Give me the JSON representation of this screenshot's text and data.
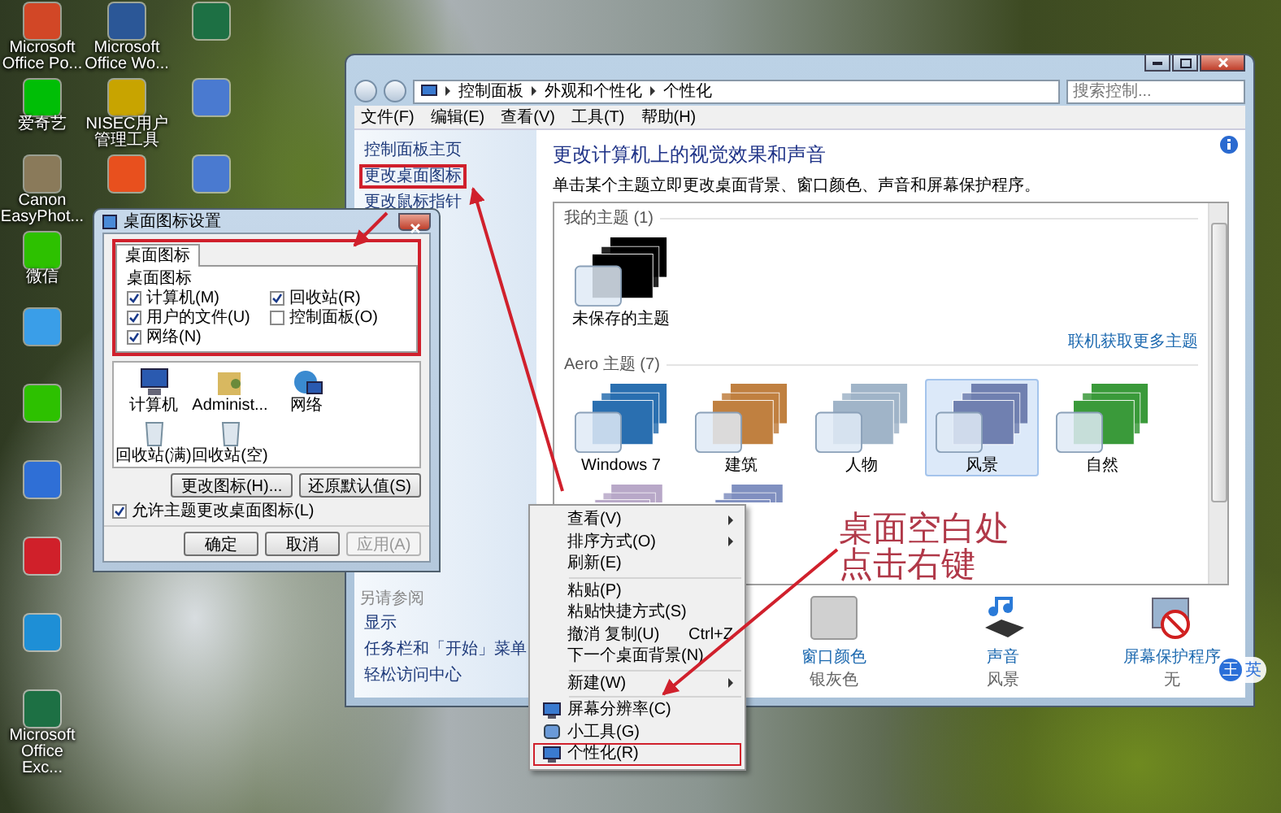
{
  "desktop_icon_columns": [
    [
      {
        "label": "Microsoft Office Po...",
        "color": "#d24726"
      },
      {
        "label": "爱奇艺",
        "color": "#00be06"
      },
      {
        "label": "Canon EasyPhot...",
        "color": "#8a7a5a"
      },
      {
        "label": "微信",
        "color": "#2dc100"
      },
      {
        "color": "#3a9ee8"
      },
      {
        "color": "#2dc100"
      },
      {
        "color": "#2f6fd6"
      },
      {
        "color": "#d0202a"
      },
      {
        "color": "#1e8fd6"
      },
      {
        "label": "Microsoft Office Exc...",
        "color": "#1d7044"
      }
    ],
    [
      {
        "label": "Microsoft Office Wo...",
        "color": "#2b5797"
      },
      {
        "label": "NISEC用户管理工具",
        "color": "#c8a400"
      },
      {
        "color": "#e8501e"
      }
    ],
    [
      {
        "color": "#1d7044"
      },
      {
        "color": "#4a7ad0"
      },
      {
        "color": "#4a7ad0"
      }
    ]
  ],
  "control_panel_window": {
    "breadcrumb": [
      "控制面板",
      "外观和个性化",
      "个性化"
    ],
    "search": {
      "placeholder": "搜索控制..."
    },
    "menu": [
      "文件(F)",
      "编辑(E)",
      "查看(V)",
      "工具(T)",
      "帮助(H)"
    ],
    "side_links": [
      {
        "label": "控制面板主页",
        "highlighted": false
      },
      {
        "label": "更改桌面图标",
        "highlighted": true
      },
      {
        "label": "更改鼠标指针",
        "highlighted": false
      }
    ],
    "see_also": {
      "title": "另请参阅",
      "links": [
        "显示",
        "任务栏和「开始」菜单",
        "轻松访问中心"
      ]
    },
    "heading": "更改计算机上的视觉效果和声音",
    "description": "单击某个主题立即更改桌面背景、窗口颜色、声音和屏幕保护程序。",
    "theme_groups": [
      {
        "title": "我的主题 (1)",
        "more_link": "联机获取更多主题",
        "themes": [
          {
            "name": "未保存的主题",
            "color": "#000000",
            "selected": false
          }
        ]
      },
      {
        "title": "Aero 主题 (7)",
        "themes": [
          {
            "name": "Windows 7",
            "color": "#2a6fb0",
            "selected": false
          },
          {
            "name": "建筑",
            "color": "#c08040",
            "selected": false
          },
          {
            "name": "人物",
            "color": "#a0b4c8",
            "selected": false
          },
          {
            "name": "风景",
            "color": "#7080b0",
            "selected": true
          },
          {
            "name": "自然",
            "color": "#3a9a3a",
            "selected": false
          },
          {
            "color": "#b8a8c8"
          },
          {
            "color": "#8090c0"
          }
        ]
      }
    ],
    "settings": [
      {
        "kind": "color",
        "title": "窗口颜色",
        "value": "银灰色"
      },
      {
        "kind": "sound",
        "title": "声音",
        "value": "风景"
      },
      {
        "kind": "screensaver",
        "title": "屏幕保护程序",
        "value": "无"
      }
    ]
  },
  "dialog": {
    "title": "桌面图标设置",
    "tabs": [
      {
        "label": "桌面图标",
        "selected": true
      }
    ],
    "highlighted": true,
    "group_title": "桌面图标",
    "checkboxes": [
      {
        "label": "计算机(M)",
        "checked": true
      },
      {
        "label": "回收站(R)",
        "checked": true
      },
      {
        "label": "用户的文件(U)",
        "checked": true
      },
      {
        "label": "控制面板(O)",
        "checked": false
      },
      {
        "label": "网络(N)",
        "checked": true
      }
    ],
    "icons": [
      {
        "label": "计算机",
        "kind": "computer"
      },
      {
        "label": "Administ...",
        "kind": "user"
      },
      {
        "label": "网络",
        "kind": "network"
      },
      {
        "label": "回收站(满)",
        "kind": "bin"
      },
      {
        "label": "回收站(空)",
        "kind": "bin"
      }
    ],
    "icon_buttons": [
      "更改图标(H)...",
      "还原默认值(S)"
    ],
    "allow_theme": {
      "label": "允许主题更改桌面图标(L)",
      "checked": true
    },
    "buttons": [
      {
        "label": "确定",
        "disabled": false
      },
      {
        "label": "取消",
        "disabled": false
      },
      {
        "label": "应用(A)",
        "disabled": true
      }
    ]
  },
  "context_menu": [
    {
      "kind": "item",
      "label": "查看(V)",
      "submenu": true,
      "highlighted": false
    },
    {
      "kind": "item",
      "label": "排序方式(O)",
      "submenu": true,
      "highlighted": false
    },
    {
      "kind": "item",
      "label": "刷新(E)",
      "submenu": false,
      "highlighted": false
    },
    {
      "kind": "separator"
    },
    {
      "kind": "item",
      "label": "粘贴(P)",
      "submenu": false,
      "highlighted": false
    },
    {
      "kind": "item",
      "label": "粘贴快捷方式(S)",
      "submenu": false,
      "highlighted": false
    },
    {
      "kind": "item",
      "label": "撤消 复制(U)",
      "shortcut": "Ctrl+Z",
      "submenu": false,
      "highlighted": false
    },
    {
      "kind": "item",
      "label": "下一个桌面背景(N)",
      "submenu": false,
      "highlighted": false
    },
    {
      "kind": "separator"
    },
    {
      "kind": "item",
      "label": "新建(W)",
      "submenu": true,
      "highlighted": false
    },
    {
      "kind": "separator"
    },
    {
      "kind": "display_item",
      "label": "屏幕分辨率(C)",
      "submenu": false,
      "highlighted": false
    },
    {
      "kind": "gadget_item",
      "label": "小工具(G)",
      "submenu": false,
      "highlighted": false
    },
    {
      "kind": "display_item",
      "label": "个性化(R)",
      "submenu": false,
      "highlighted": true
    }
  ],
  "note": {
    "lines": [
      "桌面空白处",
      "点击右键"
    ]
  },
  "ime": {
    "mode": "王",
    "language": "英"
  }
}
